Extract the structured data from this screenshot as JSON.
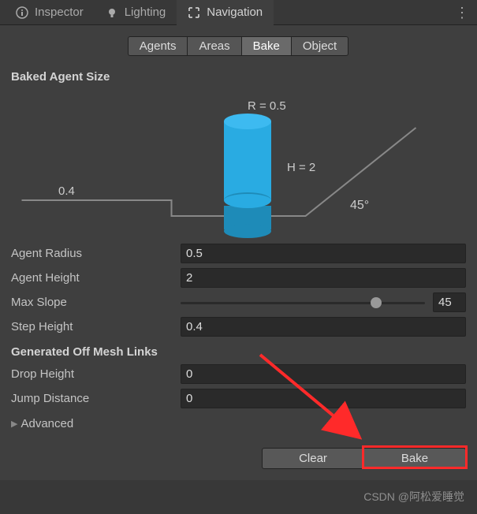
{
  "tabs": {
    "inspector": "Inspector",
    "lighting": "Lighting",
    "navigation": "Navigation"
  },
  "subtabs": {
    "agents": "Agents",
    "areas": "Areas",
    "bake": "Bake",
    "object": "Object"
  },
  "sections": {
    "baked_agent_size": "Baked Agent Size",
    "generated_links": "Generated Off Mesh Links",
    "advanced": "Advanced"
  },
  "diagram": {
    "r_label": "R = 0.5",
    "h_label": "H = 2",
    "step_label": "0.4",
    "slope_label": "45°"
  },
  "fields": {
    "agent_radius": {
      "label": "Agent Radius",
      "value": "0.5"
    },
    "agent_height": {
      "label": "Agent Height",
      "value": "2"
    },
    "max_slope": {
      "label": "Max Slope",
      "value": "45"
    },
    "step_height": {
      "label": "Step Height",
      "value": "0.4"
    },
    "drop_height": {
      "label": "Drop Height",
      "value": "0"
    },
    "jump_distance": {
      "label": "Jump Distance",
      "value": "0"
    }
  },
  "buttons": {
    "clear": "Clear",
    "bake": "Bake"
  },
  "watermark": "CSDN @阿松爱睡觉"
}
